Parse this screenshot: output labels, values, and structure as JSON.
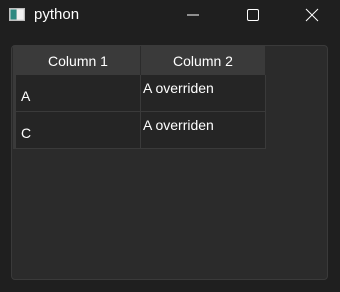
{
  "window": {
    "title": "python",
    "icon": "python-app-icon"
  },
  "controls": {
    "minimize": "minimize-icon",
    "maximize": "maximize-icon",
    "close": "close-icon"
  },
  "table": {
    "columns": [
      "Column 1",
      "Column 2"
    ],
    "rows": [
      [
        "A",
        "A overriden"
      ],
      [
        "C",
        "A overriden"
      ]
    ]
  }
}
